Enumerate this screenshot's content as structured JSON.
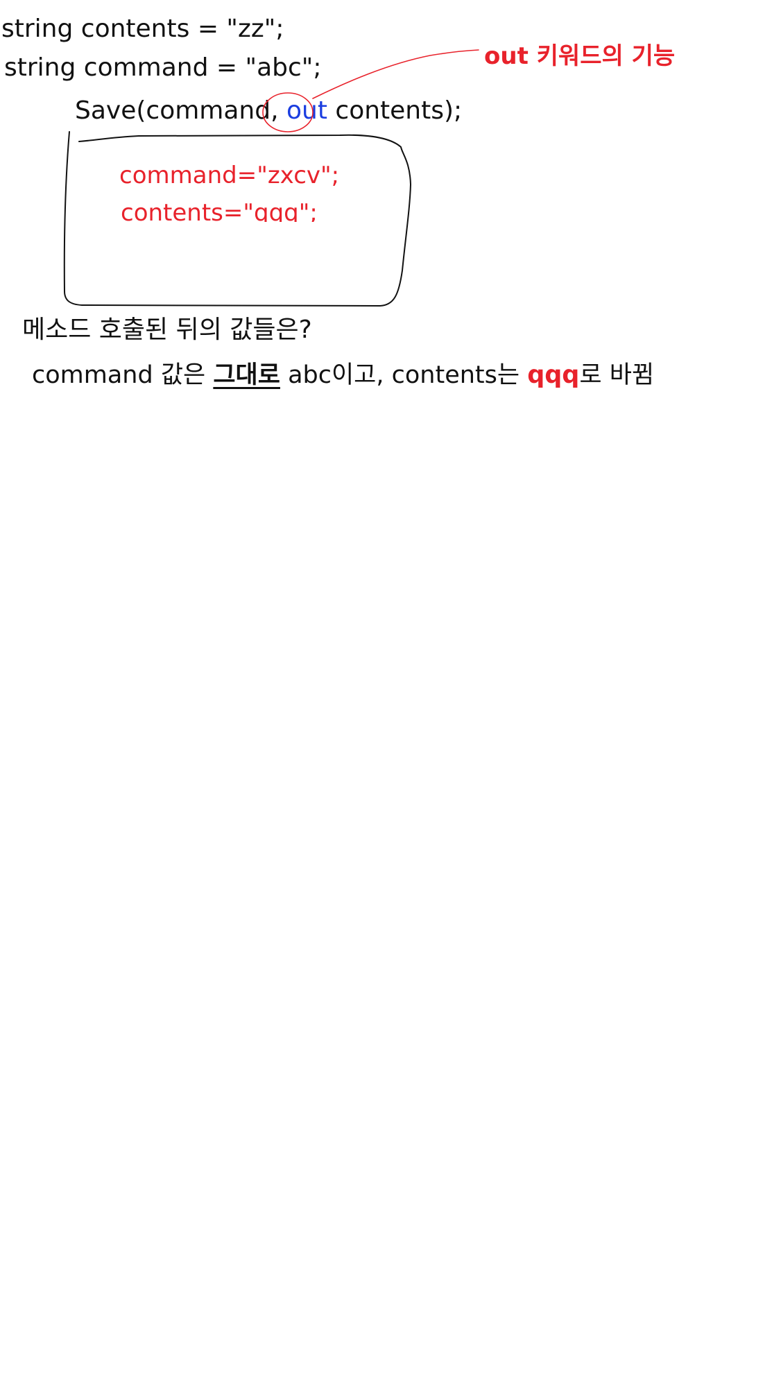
{
  "code": {
    "line1": "string contents = \"zz\";",
    "line2": "string command = \"abc\";",
    "call_prefix": "Save(command, ",
    "call_out_keyword": "out",
    "call_suffix": " contents);"
  },
  "annotation": {
    "label": "out 키워드의 기능"
  },
  "method_body": {
    "line1": "command=\"zxcv\";",
    "line2": "contents=\"qqq\";"
  },
  "question": "메소드 호출된 뒤의 값들은?",
  "answer": {
    "part1": "command 값은 ",
    "emphasis": "그대로",
    "part2": " abc이고, contents는 ",
    "highlight": "qqq",
    "part3": "로 바뀜"
  },
  "colors": {
    "ink": "#111111",
    "red": "#e8222b",
    "blue": "#1a3de0"
  }
}
